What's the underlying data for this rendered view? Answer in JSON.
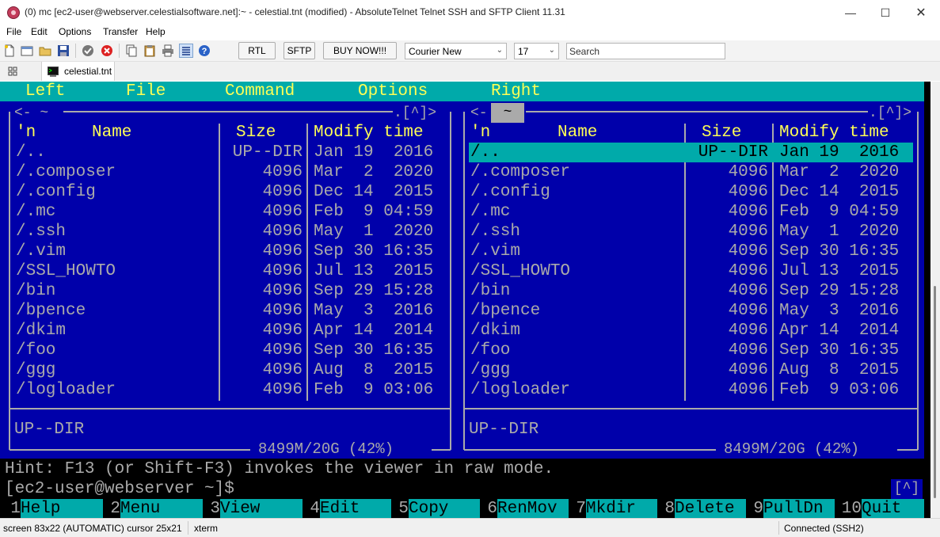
{
  "window": {
    "title": "(0) mc [ec2-user@webserver.celestialsoftware.net]:~ - celestial.tnt (modified) - AbsoluteTelnet Telnet SSH and SFTP Client 11.31",
    "minimize": "—",
    "maximize": "☐",
    "close": "✕"
  },
  "menu": [
    "File",
    "Edit",
    "Options",
    "Transfer",
    "Help"
  ],
  "toolbar": {
    "rtl_label": "RTL",
    "sftp_label": "SFTP",
    "buy_label": "BUY NOW!!!",
    "font_value": "Courier New",
    "size_value": "17",
    "search_placeholder": "Search"
  },
  "tab": {
    "label": "celestial.tnt"
  },
  "mc": {
    "menubar": {
      "left": "Left",
      "file": "File",
      "command": "Command",
      "options": "Options",
      "right": "Right"
    },
    "left_header": "<- ~",
    "right_header_arrow": "<-",
    "right_header_path": " ~ ",
    "panel_controls": ".[^]>",
    "columns": {
      "n": "'n",
      "name": "Name",
      "size": "Size",
      "mtime": "Modify time"
    },
    "files": [
      {
        "name": "/..",
        "size": "UP--DIR",
        "mtime": "Jan 19  2016"
      },
      {
        "name": "/.composer",
        "size": "4096",
        "mtime": "Mar  2  2020"
      },
      {
        "name": "/.config",
        "size": "4096",
        "mtime": "Dec 14  2015"
      },
      {
        "name": "/.mc",
        "size": "4096",
        "mtime": "Feb  9 04:59"
      },
      {
        "name": "/.ssh",
        "size": "4096",
        "mtime": "May  1  2020"
      },
      {
        "name": "/.vim",
        "size": "4096",
        "mtime": "Sep 30 16:35"
      },
      {
        "name": "/SSL_HOWTO",
        "size": "4096",
        "mtime": "Jul 13  2015"
      },
      {
        "name": "/bin",
        "size": "4096",
        "mtime": "Sep 29 15:28"
      },
      {
        "name": "/bpence",
        "size": "4096",
        "mtime": "May  3  2016"
      },
      {
        "name": "/dkim",
        "size": "4096",
        "mtime": "Apr 14  2014"
      },
      {
        "name": "/foo",
        "size": "4096",
        "mtime": "Sep 30 16:35"
      },
      {
        "name": "/ggg",
        "size": "4096",
        "mtime": "Aug  8  2015"
      },
      {
        "name": "/logloader",
        "size": "4096",
        "mtime": "Feb  9 03:06"
      }
    ],
    "mini_status": "UP--DIR",
    "disk_usage": "8499M/20G (42%)",
    "hint": "Hint: F13 (or Shift-F3) invokes the viewer in raw mode.",
    "prompt": "[ec2-user@webserver ~]$",
    "prompt_corner": "[^]",
    "fkeys": [
      {
        "num": "1",
        "label": "Help"
      },
      {
        "num": "2",
        "label": "Menu"
      },
      {
        "num": "3",
        "label": "View"
      },
      {
        "num": "4",
        "label": "Edit"
      },
      {
        "num": "5",
        "label": "Copy"
      },
      {
        "num": "6",
        "label": "RenMov"
      },
      {
        "num": "7",
        "label": "Mkdir"
      },
      {
        "num": "8",
        "label": "Delete"
      },
      {
        "num": "9",
        "label": "PullDn"
      },
      {
        "num": "10",
        "label": "Quit"
      }
    ]
  },
  "status": {
    "screen": "screen 83x22 (AUTOMATIC) cursor 25x21",
    "term": "xterm",
    "connection": "Connected (SSH2)"
  },
  "colors": {
    "mc_blue": "#0000aa",
    "mc_cyan": "#00aaaa",
    "mc_text": "#aaaaaa",
    "mc_yellow": "#ffff55",
    "mc_white": "#ffffff"
  }
}
